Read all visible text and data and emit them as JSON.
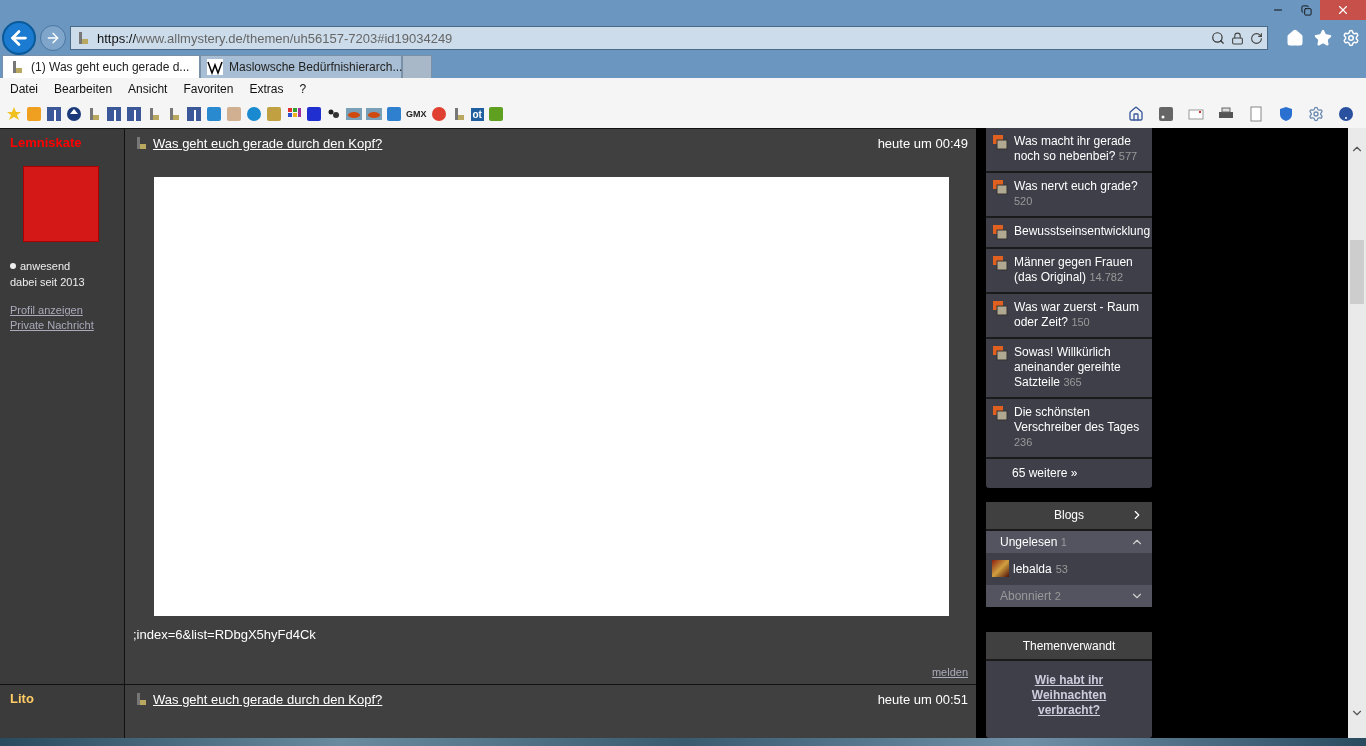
{
  "address_bar": {
    "scheme": "https://",
    "host": "www.allmystery.de",
    "path": "/themen/uh56157-7203#id19034249"
  },
  "tabs": [
    {
      "title": "(1) Was geht euch gerade d...",
      "selected": true
    },
    {
      "title": "Maslowsche Bedürfnishierarch...",
      "selected": false
    }
  ],
  "menu": [
    "Datei",
    "Bearbeiten",
    "Ansicht",
    "Favoriten",
    "Extras",
    "?"
  ],
  "favorites": [
    {
      "kind": "star"
    },
    {
      "kind": "aldi"
    },
    {
      "kind": "fb"
    },
    {
      "kind": "circle"
    },
    {
      "kind": "page"
    },
    {
      "kind": "fb"
    },
    {
      "kind": "fb"
    },
    {
      "kind": "page"
    },
    {
      "kind": "page"
    },
    {
      "kind": "fb"
    },
    {
      "kind": "s"
    },
    {
      "kind": "photo"
    },
    {
      "kind": "hp"
    },
    {
      "kind": "gif"
    },
    {
      "kind": "grid"
    },
    {
      "kind": "l"
    },
    {
      "kind": "dots"
    },
    {
      "kind": "car"
    },
    {
      "kind": "car"
    },
    {
      "kind": "ie"
    },
    {
      "kind": "label",
      "text": "GMX"
    },
    {
      "kind": "g"
    },
    {
      "kind": "page"
    },
    {
      "kind": "label",
      "text": "ot"
    },
    {
      "kind": "r"
    }
  ],
  "posts": [
    {
      "author": "Lemniskate",
      "color": "#ff0000",
      "title": "Was geht euch gerade durch den Kopf?",
      "time": "heute um 00:49",
      "status": "anwesend",
      "since": "dabei seit 2013",
      "links": [
        "Profil anzeigen",
        "Private Nachricht"
      ],
      "body": ";index=6&list=RDbgX5hyFd4Ck",
      "report": "melden"
    },
    {
      "author": "Lito",
      "color": "#ffcc66",
      "title": "Was geht euch gerade durch den Kopf?",
      "time": "heute um 00:51"
    }
  ],
  "threads": [
    {
      "title": "Was macht ihr gerade noch so nebenbei?",
      "count": "577"
    },
    {
      "title": "Was nervt euch grade?",
      "count": "520"
    },
    {
      "title": "Bewusstseinsentwicklung"
    },
    {
      "title": "Männer gegen Frauen (das Original)",
      "count": "14.782"
    },
    {
      "title": "Was war zuerst - Raum oder Zeit?",
      "count": "150"
    },
    {
      "title": "Sowas! Willkürlich aneinander gereihte Satzteile",
      "count": "365"
    },
    {
      "title": "Die schönsten Verschreiber des Tages",
      "count": "236"
    }
  ],
  "threads_more": "65 weitere »",
  "blogs": {
    "title": "Blogs",
    "sections": [
      {
        "label": "Ungelesen",
        "count": "1",
        "expanded": true,
        "items": [
          {
            "name": "lebalda",
            "count": "53"
          }
        ]
      },
      {
        "label": "Abonniert",
        "count": "2",
        "expanded": false
      }
    ]
  },
  "related": {
    "title": "Themenverwandt",
    "link": "Wie habt ihr Weihnachten verbracht?"
  }
}
